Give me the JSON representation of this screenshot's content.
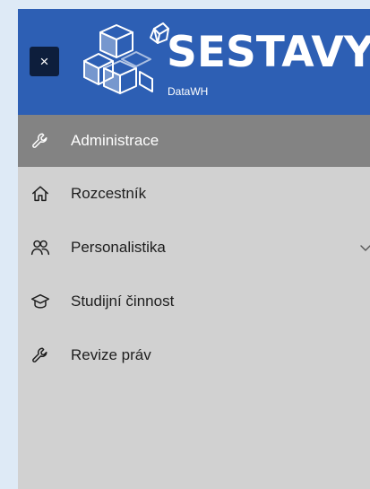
{
  "header": {
    "close_label": "×",
    "brand_title": "SESTAVY",
    "brand_subtitle": "DataWH",
    "background_color": "#2d5fb4"
  },
  "menu": {
    "items": [
      {
        "label": "Administrace",
        "icon": "wrench-icon",
        "active": true
      },
      {
        "label": "Rozcestník",
        "icon": "home-icon",
        "active": false
      },
      {
        "label": "Personalistika",
        "icon": "people-icon",
        "active": false,
        "expandable": true
      },
      {
        "label": "Studijní činnost",
        "icon": "graduation-cap-icon",
        "active": false
      },
      {
        "label": "Revize práv",
        "icon": "wrench-icon",
        "active": false
      }
    ],
    "active_color": "#838383",
    "background_color": "#d1d1d1"
  }
}
